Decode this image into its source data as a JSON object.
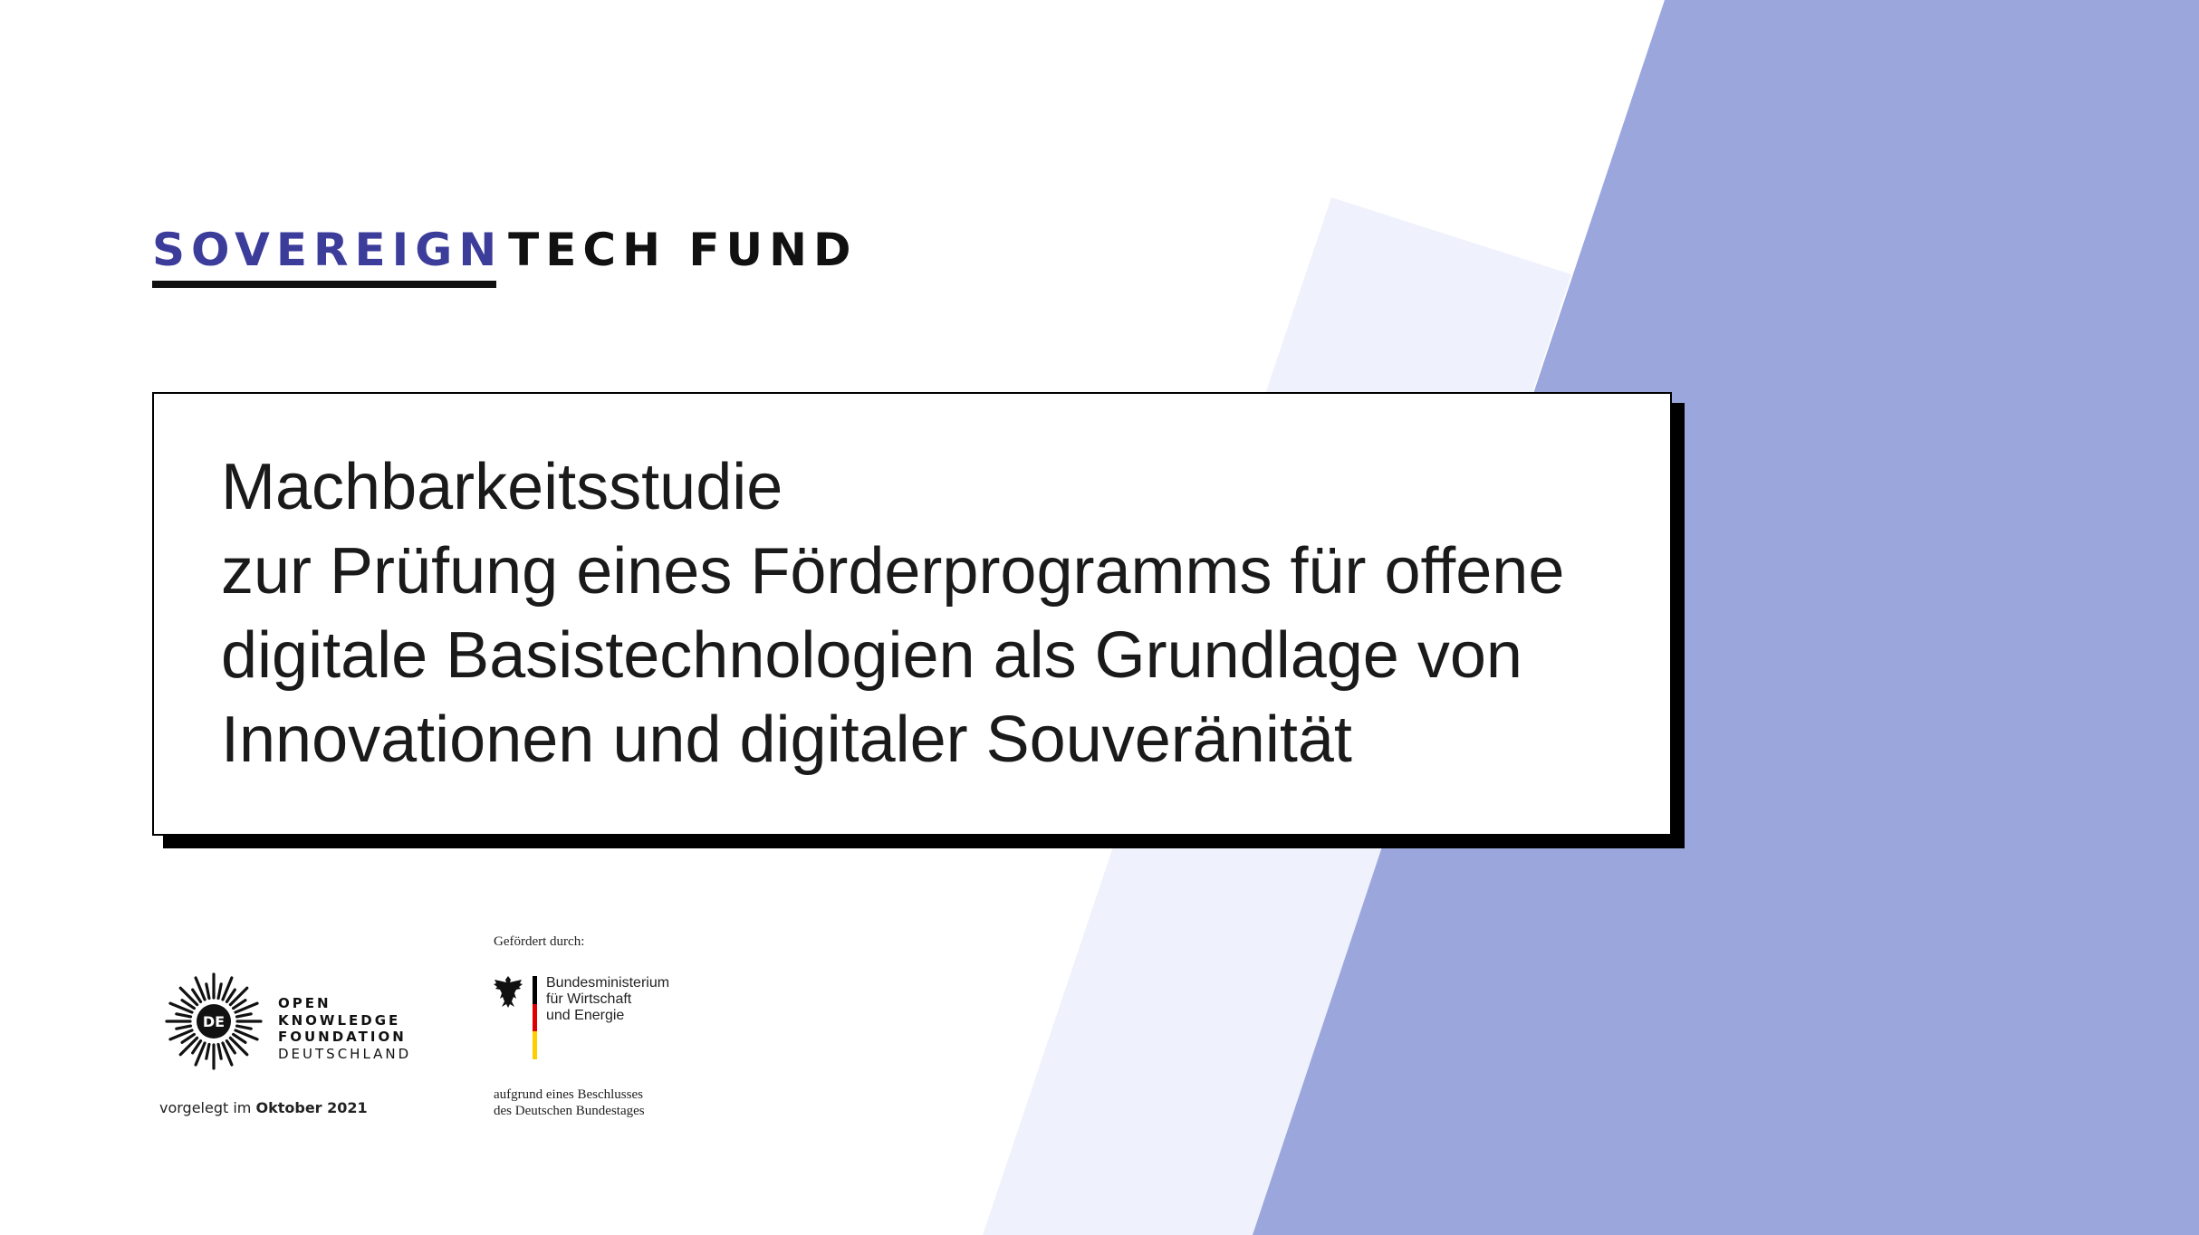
{
  "colors": {
    "background": "#ffffff",
    "accent_blue": "#3c3c9b",
    "band_blue": "#9ba7dc",
    "band_light": "#eff2fc",
    "text": "#1a1a1a"
  },
  "brand": {
    "part1": "SOVEREIGN",
    "part2": "TECH FUND"
  },
  "title": {
    "lines": [
      "Machbarkeitsstudie",
      "zur Prüfung eines Förderprogramms für offene",
      "digitale Basistechnologien als Grundlage von",
      "Innovationen und digitaler Souveränität"
    ]
  },
  "okf": {
    "badge": "DE",
    "lines": [
      "OPEN",
      "KNOWLEDGE",
      "FOUNDATION",
      "DEUTSCHLAND"
    ]
  },
  "submitted": {
    "prefix": "vorgelegt im",
    "date": "Oktober 2021"
  },
  "funding": {
    "label": "Gefördert durch:",
    "ministry_lines": [
      "Bundesministerium",
      "für Wirtschaft",
      "und Energie"
    ],
    "resolution_lines": [
      "aufgrund eines Beschlusses",
      "des Deutschen Bundestages"
    ]
  }
}
